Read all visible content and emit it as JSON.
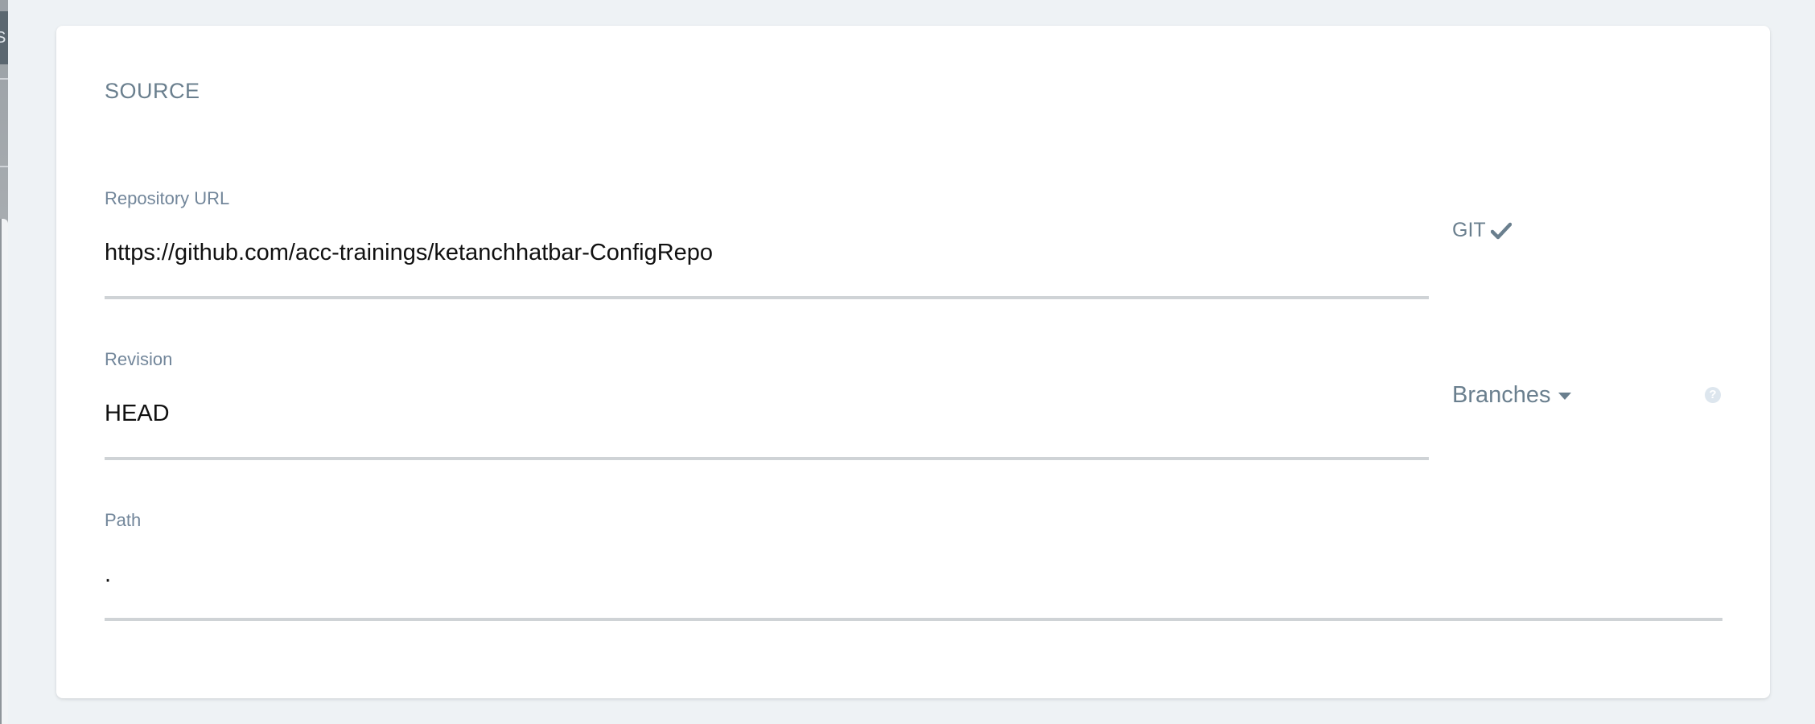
{
  "left_edge": {
    "tab_char": "S"
  },
  "source": {
    "title": "SOURCE",
    "repository": {
      "label": "Repository URL",
      "value": "https://github.com/acc-trainings/ketanchhatbar-ConfigRepo",
      "type_label": "GIT",
      "type_icon": "check-icon"
    },
    "revision": {
      "label": "Revision",
      "value": "HEAD",
      "dropdown_label": "Branches",
      "dropdown_icon": "caret-down-icon",
      "help_icon": "question-circle-icon",
      "help_char": "?"
    },
    "path": {
      "label": "Path",
      "value": "."
    }
  },
  "colors": {
    "page_bg": "#eef2f5",
    "card_bg": "#ffffff",
    "label": "#72869a",
    "muted": "#6a7f8e",
    "underline": "#cfd3d6",
    "help_bg": "#dde6ee"
  }
}
